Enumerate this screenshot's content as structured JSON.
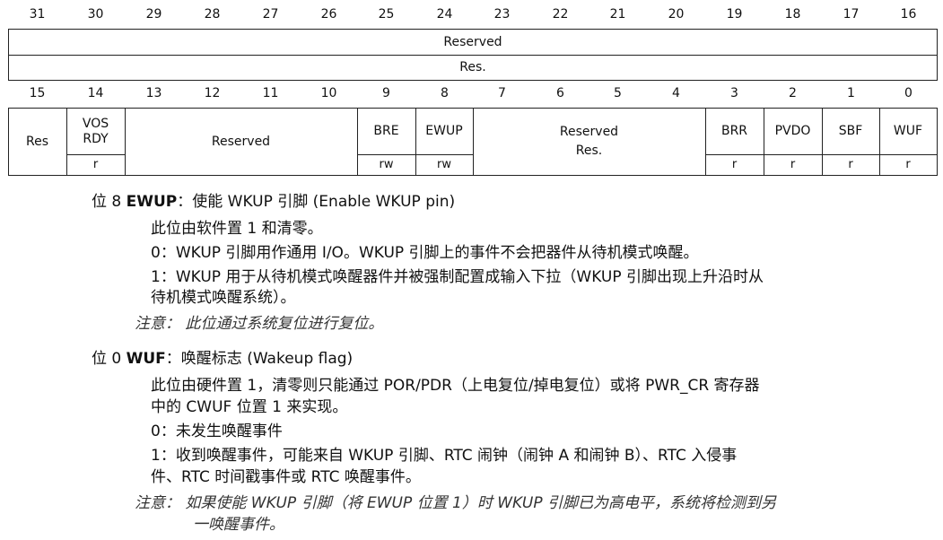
{
  "register": {
    "high_bits": [
      "31",
      "30",
      "29",
      "28",
      "27",
      "26",
      "25",
      "24",
      "23",
      "22",
      "21",
      "20",
      "19",
      "18",
      "17",
      "16"
    ],
    "low_bits": [
      "15",
      "14",
      "13",
      "12",
      "11",
      "10",
      "9",
      "8",
      "7",
      "6",
      "5",
      "4",
      "3",
      "2",
      "1",
      "0"
    ],
    "reserved_label": "Reserved",
    "res_label": "Res.",
    "fields": {
      "res": "Res",
      "vosrdy_line1": "VOS",
      "vosrdy_line2": "RDY",
      "reserved_mid": "Reserved",
      "bre": "BRE",
      "ewup": "EWUP",
      "reserved_low_1": "Reserved",
      "reserved_low_2": "Res.",
      "brr": "BRR",
      "pvdo": "PVDO",
      "sbf": "SBF",
      "wuf": "WUF"
    },
    "access": {
      "vosrdy": "r",
      "bre": "rw",
      "ewup": "rw",
      "brr": "r",
      "pvdo": "r",
      "sbf": "r",
      "wuf": "r"
    }
  },
  "bit8": {
    "prefix": "位 8 ",
    "name": "EWUP",
    "title_rest": "：使能 WKUP 引脚 (Enable WKUP pin)",
    "line1": "此位由软件置 1 和清零。",
    "line2": "0：WKUP 引脚用作通用 I/O。WKUP 引脚上的事件不会把器件从待机模式唤醒。",
    "line3a": "1：WKUP 用于从待机模式唤醒器件并被强制配置成输入下拉（WKUP 引脚出现上升沿时从",
    "line3b": "待机模式唤醒系统）。",
    "note": "注意：  此位通过系统复位进行复位。"
  },
  "bit0": {
    "prefix": "位 0 ",
    "name": "WUF",
    "title_rest": "：唤醒标志 (Wakeup flag)",
    "line1a": "此位由硬件置 1，清零则只能通过 POR/PDR（上电复位/掉电复位）或将 PWR_CR 寄存器",
    "line1b": "中的 CWUF 位置 1 来实现。",
    "line2": "0：未发生唤醒事件",
    "line3a": "1：收到唤醒事件，可能来自 WKUP 引脚、RTC 闹钟（闹钟 A 和闹钟 B）、RTC 入侵事",
    "line3b": "件、RTC 时间戳事件或 RTC 唤醒事件。",
    "note_a": "注意：  如果使能 WKUP 引脚（将 EWUP 位置 1）时 WKUP 引脚已为高电平，系统将检测到另",
    "note_b": "一唤醒事件。"
  }
}
